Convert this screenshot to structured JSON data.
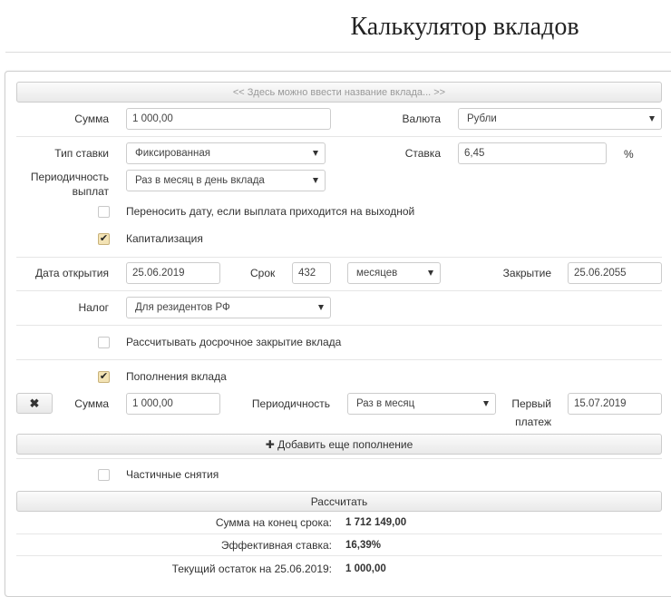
{
  "title": "Калькулятор вкладов",
  "deposit_name_button": "<< Здесь можно ввести название вклада... >>",
  "amount": {
    "label": "Сумма",
    "value": "1 000,00"
  },
  "currency": {
    "label": "Валюта",
    "value": "Рубли"
  },
  "rate_type": {
    "label": "Тип ставки",
    "value": "Фиксированная"
  },
  "rate": {
    "label": "Ставка",
    "value": "6,45",
    "unit": "%"
  },
  "payout": {
    "label_line1": "Периодичность",
    "label_line2": "выплат",
    "value": "Раз в месяц в день вклада"
  },
  "move_date": {
    "label": "Переносить дату, если выплата приходится на выходной",
    "checked": false
  },
  "capitalization": {
    "label": "Капитализация",
    "checked": true
  },
  "open_date": {
    "label": "Дата открытия",
    "value": "25.06.2019"
  },
  "term": {
    "label": "Срок",
    "value": "432",
    "unit_value": "месяцев"
  },
  "close_date": {
    "label": "Закрытие",
    "value": "25.06.2055"
  },
  "tax": {
    "label": "Налог",
    "value": "Для резидентов РФ"
  },
  "early_close": {
    "label": "Рассчитывать досрочное закрытие вклада",
    "checked": false
  },
  "replenishment": {
    "label": "Пополнения вклада",
    "checked": true,
    "remove_icon": "✖",
    "amount_label": "Сумма",
    "amount_value": "1 000,00",
    "period_label": "Периодичность",
    "period_value": "Раз в месяц",
    "first_label_line1": "Первый",
    "first_label_line2": "платеж",
    "first_value": "15.07.2019",
    "add_icon": "✚",
    "add_label": "Добавить еще пополнение"
  },
  "partial_withdrawals": {
    "label": "Частичные снятия",
    "checked": false
  },
  "calculate_label": "Рассчитать",
  "results": {
    "end_sum_label": "Сумма на конец срока:",
    "end_sum_value": "1 712 149,00",
    "eff_rate_label": "Эффективная ставка:",
    "eff_rate_value": "16,39%",
    "balance_label": "Текущий остаток на 25.06.2019:",
    "balance_value": "1 000,00"
  },
  "colors": {
    "checkbox_checked_bg": "#f3e3b5",
    "border": "#cccccc",
    "text": "#333333"
  }
}
